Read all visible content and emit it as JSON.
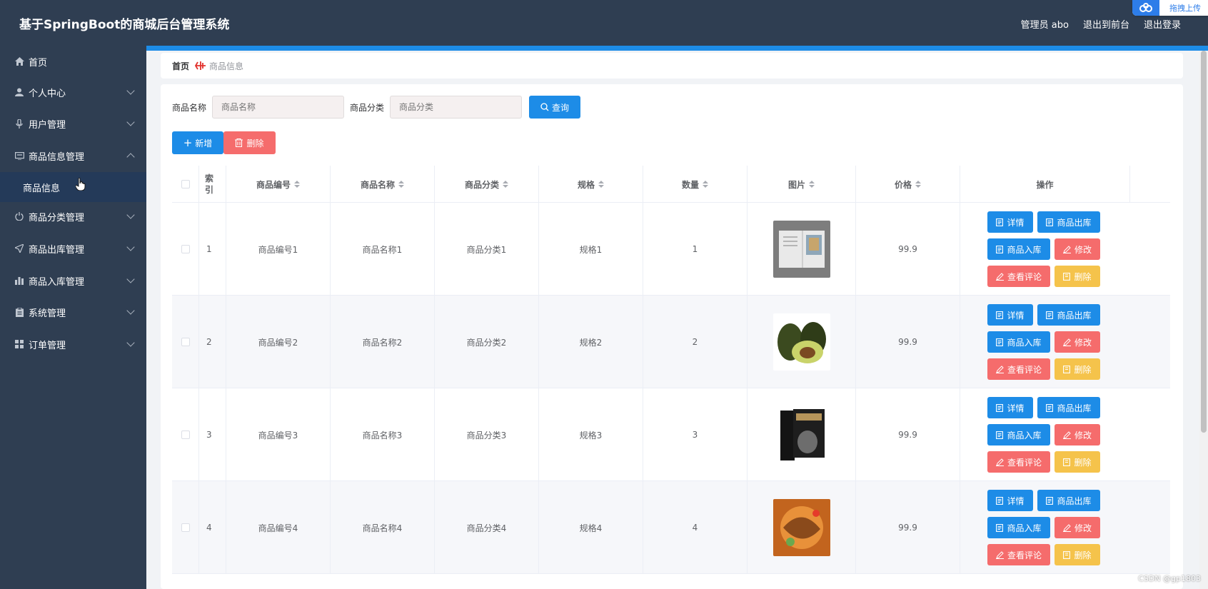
{
  "header": {
    "title": "基于SpringBoot的商城后台管理系统",
    "admin": "管理员 abo",
    "back_front": "退出到前台",
    "logout": "退出登录",
    "upload": "拖拽上传"
  },
  "sidebar": {
    "items": [
      {
        "label": "首页",
        "icon": "home-icon"
      },
      {
        "label": "个人中心",
        "icon": "user-icon"
      },
      {
        "label": "用户管理",
        "icon": "microphone-icon"
      },
      {
        "label": "商品信息管理",
        "icon": "monitor-icon"
      },
      {
        "label": "商品分类管理",
        "icon": "power-icon"
      },
      {
        "label": "商品出库管理",
        "icon": "send-icon"
      },
      {
        "label": "商品入库管理",
        "icon": "chart-icon"
      },
      {
        "label": "系统管理",
        "icon": "clipboard-icon"
      },
      {
        "label": "订单管理",
        "icon": "grid-icon"
      }
    ],
    "sub_item": "商品信息"
  },
  "breadcrumb": {
    "home": "首页",
    "current": "商品信息"
  },
  "search": {
    "name_label": "商品名称",
    "name_placeholder": "商品名称",
    "category_label": "商品分类",
    "category_placeholder": "商品分类",
    "query": "查询"
  },
  "toolbar": {
    "add": "新增",
    "delete": "删除"
  },
  "table": {
    "columns": [
      "索引",
      "商品编号",
      "商品名称",
      "商品分类",
      "规格",
      "数量",
      "图片",
      "价格",
      "操作"
    ],
    "rows": [
      {
        "index": "1",
        "code": "商品编号1",
        "name": "商品名称1",
        "category": "商品分类1",
        "spec": "规格1",
        "qty": "1",
        "price": "99.9"
      },
      {
        "index": "2",
        "code": "商品编号2",
        "name": "商品名称2",
        "category": "商品分类2",
        "spec": "规格2",
        "qty": "2",
        "price": "99.9"
      },
      {
        "index": "3",
        "code": "商品编号3",
        "name": "商品名称3",
        "category": "商品分类3",
        "spec": "规格3",
        "qty": "3",
        "price": "99.9"
      },
      {
        "index": "4",
        "code": "商品编号4",
        "name": "商品名称4",
        "category": "商品分类4",
        "spec": "规格4",
        "qty": "4",
        "price": "99.9"
      }
    ],
    "actions": {
      "detail": "详情",
      "out": "商品出库",
      "in": "商品入库",
      "edit": "修改",
      "comments": "查看评论",
      "delete": "删除"
    }
  },
  "watermark": "CSDN @gp1803",
  "colors": {
    "header": "#2f3e52",
    "accent": "#1d8ce7",
    "danger": "#f56c6c",
    "warning": "#f5c34b"
  }
}
